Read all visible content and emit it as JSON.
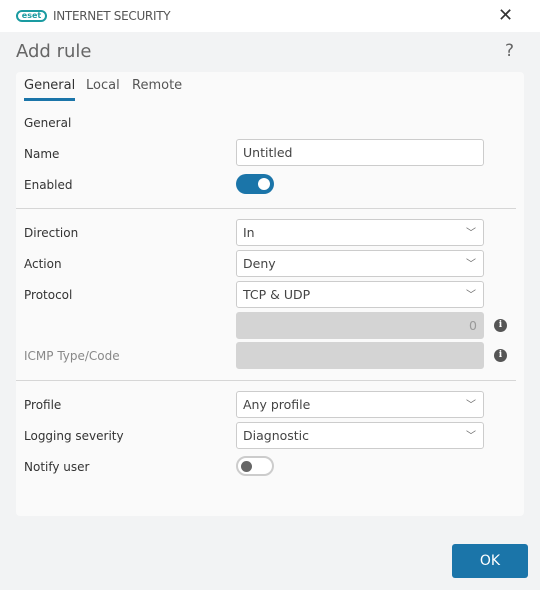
{
  "app": {
    "logo": "eset",
    "product": "INTERNET SECURITY"
  },
  "dialog": {
    "title": "Add rule",
    "help": "?"
  },
  "tabs": [
    {
      "label": "General"
    },
    {
      "label": "Local"
    },
    {
      "label": "Remote"
    }
  ],
  "form": {
    "section": "General",
    "name": {
      "label": "Name",
      "value": "Untitled"
    },
    "enabled": {
      "label": "Enabled",
      "on": true
    },
    "direction": {
      "label": "Direction",
      "value": "In"
    },
    "action": {
      "label": "Action",
      "value": "Deny"
    },
    "protocol": {
      "label": "Protocol",
      "value": "TCP & UDP",
      "number": "0"
    },
    "icmp": {
      "label": "ICMP Type/Code",
      "value": ""
    },
    "profile": {
      "label": "Profile",
      "value": "Any profile"
    },
    "logging": {
      "label": "Logging severity",
      "value": "Diagnostic"
    },
    "notify": {
      "label": "Notify user",
      "on": false
    }
  },
  "ok_label": "OK",
  "accent": "#1b75a9"
}
